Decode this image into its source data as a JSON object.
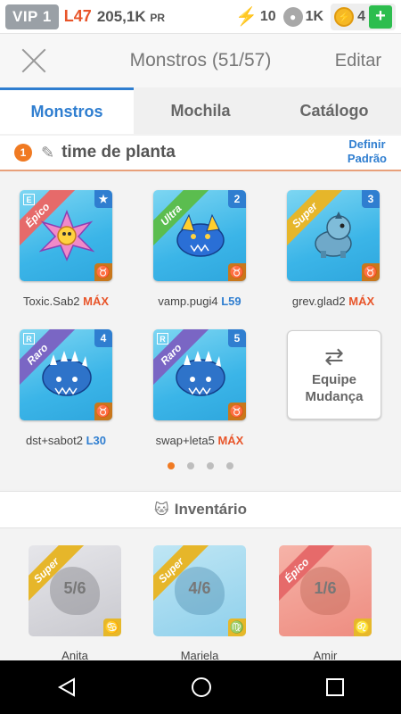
{
  "status": {
    "vip": "VIP 1",
    "level": "L47",
    "power_value": "205,1K",
    "power_unit": "PR",
    "energy": "10",
    "food": "1K",
    "coins": "4",
    "add_label": "+"
  },
  "header": {
    "title": "Monstros (51/57)",
    "edit": "Editar"
  },
  "tabs": [
    "Monstros",
    "Mochila",
    "Catálogo"
  ],
  "team": {
    "number": "1",
    "name": "time de planta",
    "set_default_line1": "Definir",
    "set_default_line2": "Padrão"
  },
  "team_monsters": [
    {
      "name": "Toxic.Sab2",
      "level": "MÁX",
      "rarity": "Épico",
      "slot": "★",
      "class": "E"
    },
    {
      "name": "vamp.pugi4",
      "level": "L59",
      "rarity": "Ultra",
      "slot": "2",
      "class": ""
    },
    {
      "name": "grev.glad2",
      "level": "MÁX",
      "rarity": "Super",
      "slot": "3",
      "class": ""
    },
    {
      "name": "dst+sabot2",
      "level": "L30",
      "rarity": "Raro",
      "slot": "4",
      "class": "R"
    },
    {
      "name": "swap+leta5",
      "level": "MÁX",
      "rarity": "Raro",
      "slot": "5",
      "class": "R"
    }
  ],
  "swap_button": {
    "line1": "Equipe",
    "line2": "Mudança"
  },
  "inventory": {
    "title": "Inventário",
    "items": [
      {
        "name": "Anita",
        "fragments": "5/6",
        "rarity": "Super",
        "zodiac": "♋"
      },
      {
        "name": "Mariela",
        "fragments": "4/6",
        "rarity": "Super",
        "zodiac": "♍"
      },
      {
        "name": "Amir",
        "fragments": "1/6",
        "rarity": "Épico",
        "zodiac": "♌"
      }
    ]
  },
  "zodiac_symbol": "♉",
  "colors": {
    "accent_orange": "#e8552a",
    "accent_blue": "#2f7ed0",
    "epico": "#e66a6a",
    "ultra": "#5bbd4f",
    "super": "#e6b62a",
    "raro": "#7a66c4"
  }
}
